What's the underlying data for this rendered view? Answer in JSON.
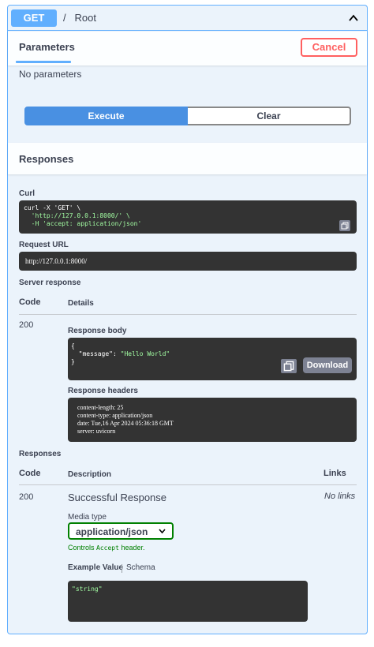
{
  "operation": {
    "method": "GET",
    "path": "/",
    "summary": "Root"
  },
  "parameters": {
    "tab_label": "Parameters",
    "cancel_label": "Cancel",
    "empty_text": "No parameters"
  },
  "actions": {
    "execute_label": "Execute",
    "clear_label": "Clear"
  },
  "responses_section": {
    "title": "Responses"
  },
  "live_response": {
    "curl_label": "Curl",
    "curl_lines": [
      "curl -X 'GET' \\",
      "  'http://127.0.0.1:8000/' \\",
      "  -H 'accept: application/json'"
    ],
    "request_url_label": "Request URL",
    "request_url": "http://127.0.0.1:8000/",
    "server_response_label": "Server response",
    "code_header": "Code",
    "details_header": "Details",
    "code": "200",
    "response_body_label": "Response body",
    "response_body_lines": [
      "{",
      "  \"message\": \"Hello World\"",
      "}"
    ],
    "download_label": "Download",
    "response_headers_label": "Response headers",
    "response_headers_lines": [
      "content-length: 25",
      "content-type: application/json",
      "date: Tue,16 Apr 2024 05:36:18 GMT",
      "server: uvicorn"
    ]
  },
  "documented_responses": {
    "title": "Responses",
    "code_header": "Code",
    "description_header": "Description",
    "links_header": "Links",
    "code": "200",
    "description": "Successful Response",
    "links": "No links",
    "media_type_label": "Media type",
    "media_type": "application/json",
    "controls_prefix": "Controls",
    "controls_code": "Accept",
    "controls_suffix": "header.",
    "example_tab": "Example Value",
    "schema_tab": "Schema",
    "example_value": "\"string\""
  },
  "colors": {
    "accent": "#61affe",
    "execute": "#4990e2",
    "cancel": "#ff6060",
    "code_bg": "#333333",
    "string_green": "#a2fca2"
  }
}
